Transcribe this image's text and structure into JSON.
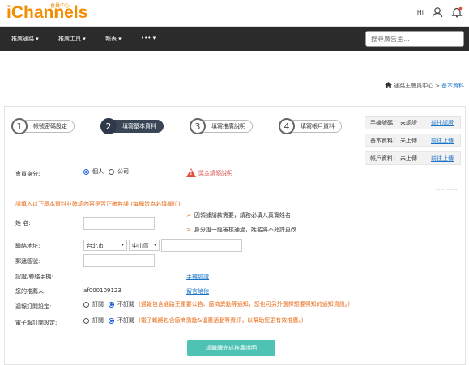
{
  "header": {
    "logo": "iChannels",
    "logo_sub": "會員中心",
    "greeting": "Hi"
  },
  "nav": {
    "items": [
      "推廣通路",
      "推廣工具",
      "報表",
      "•••"
    ],
    "search_placeholder": "搜尋廣告主..."
  },
  "breadcrumb": {
    "parent": "通路王會員中心",
    "separator": ">",
    "current": "基本資料"
  },
  "steps": [
    {
      "num": "1",
      "label": "帳號密碼設定"
    },
    {
      "num": "2",
      "label": "填寫基本資料"
    },
    {
      "num": "3",
      "label": "填寫推廣說明"
    },
    {
      "num": "4",
      "label": "填寫帳戶資料"
    }
  ],
  "status": [
    {
      "key": "手機號碼：",
      "value": "未認證",
      "action": "前往認證"
    },
    {
      "key": "基本資料：",
      "value": "未上傳",
      "action": "前往上傳"
    },
    {
      "key": "帳戶資料：",
      "value": "未上傳",
      "action": "前往上傳"
    }
  ],
  "form": {
    "member_type_label": "會員身分:",
    "opt_personal": "個人",
    "opt_company": "公司",
    "warning": "獎金請領說明",
    "notice": "請填入以下基本資料並確認內容是否正確無誤 (每欄皆為必填欄位):",
    "name_label": "姓 名:",
    "name_hint1": "因領據請款需要，請務必填入真實姓名",
    "name_hint2": "身分證一經審核通過，姓名將不允許更改",
    "hint_marker": ">",
    "address_label": "聯絡地址:",
    "city": "台北市",
    "district": "中山區",
    "zip_label": "郵遞區號:",
    "phone_label": "認證/聯絡手機:",
    "phone_link": "手機驗證",
    "referrer_label": "您的推薦人:",
    "referrer_value": "af000109123",
    "referrer_link": "留言給他",
    "weekly_label": "週報訂閱設定:",
    "subscribe": "訂閱",
    "unsubscribe": "不訂閱",
    "weekly_note": "(週報包含通路王重要公告、廠商異動等通知，您也可另外選擇想要得知的通知資訊。)",
    "epaper_label": "電子報訂閱設定:",
    "epaper_note": "(電子報將包含廠商激勵&優惠活動等資訊，以幫助您更有效推廣。)",
    "submit": "請繼續完成推廣說明"
  }
}
